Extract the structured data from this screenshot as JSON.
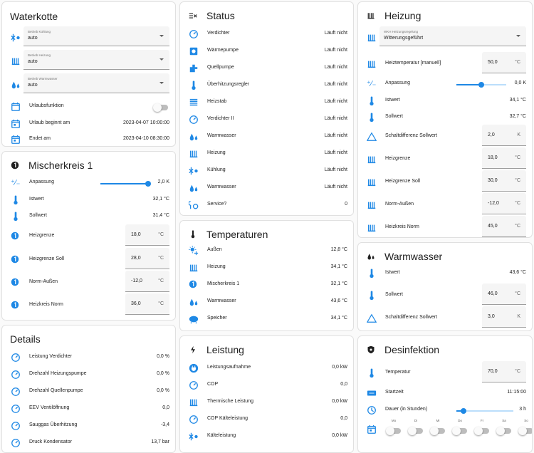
{
  "waterkotte": {
    "title": "Waterkotte",
    "selects": [
      {
        "label": "Betrieb Kühlung",
        "value": "auto"
      },
      {
        "label": "Betrieb Heizung",
        "value": "auto"
      },
      {
        "label": "Betrieb Warmwasser",
        "value": "auto"
      }
    ],
    "urlaub_label": "Urlaubsfunktion",
    "rows": [
      {
        "label": "Urlaub beginnt am",
        "value": "2023-04-07 10:00:00"
      },
      {
        "label": "Endet am",
        "value": "2023-04-10 08:30:00"
      }
    ]
  },
  "mischer": {
    "title": "Mischerkreis 1",
    "anpassung_label": "Anpassung",
    "anpassung_value": "2,0 K",
    "anpassung_fraction": 0.95,
    "rows": [
      {
        "label": "Istwert",
        "value": "32,1 °C"
      },
      {
        "label": "Sollwert",
        "value": "31,4 °C"
      }
    ],
    "inputs": [
      {
        "label": "Heizgrenze",
        "value": "18,0",
        "unit": "°C"
      },
      {
        "label": "Heizgrenze Soll",
        "value": "28,0",
        "unit": "°C"
      },
      {
        "label": "Norm-Außen",
        "value": "-12,0",
        "unit": "°C"
      },
      {
        "label": "Heizkreis Norm",
        "value": "36,0",
        "unit": "°C"
      }
    ]
  },
  "details": {
    "title": "Details",
    "rows": [
      {
        "label": "Leistung Verdichter",
        "value": "0,0 %"
      },
      {
        "label": "Drehzahl Heizungspumpe",
        "value": "0,0 %"
      },
      {
        "label": "Drehzahl Quellenpumpe",
        "value": "0,0 %"
      },
      {
        "label": "EEV Ventilöffnung",
        "value": "0,0"
      },
      {
        "label": "Sauggas Überhitzung",
        "value": "-3,4"
      },
      {
        "label": "Druck Kondensator",
        "value": "13,7 bar"
      }
    ]
  },
  "status": {
    "title": "Status",
    "rows": [
      {
        "label": "Verdichter",
        "value": "Läuft nicht",
        "icon": "gauge-icon"
      },
      {
        "label": "Wärmepumpe",
        "value": "Läuft nicht",
        "icon": "heat-pump-icon"
      },
      {
        "label": "Quellpumpe",
        "value": "Läuft nicht",
        "icon": "pump-icon"
      },
      {
        "label": "Überhitzungsregler",
        "value": "Läuft nicht",
        "icon": "thermometer-icon"
      },
      {
        "label": "Heizstab",
        "value": "Läuft nicht",
        "icon": "heating-rod-icon"
      },
      {
        "label": "Verdichter II",
        "value": "Läuft nicht",
        "icon": "gauge-icon"
      },
      {
        "label": "Warmwasser",
        "value": "Läuft nicht",
        "icon": "water-drops-icon"
      },
      {
        "label": "Heizung",
        "value": "Läuft nicht",
        "icon": "radiator-icon"
      },
      {
        "label": "Kühlung",
        "value": "Läuft nicht",
        "icon": "snow-sun-icon"
      },
      {
        "label": "Warmwasser",
        "value": "Läuft nicht",
        "icon": "water-drops-icon"
      },
      {
        "label": "Service?",
        "value": "0",
        "icon": "service-icon"
      }
    ]
  },
  "temperaturen": {
    "title": "Temperaturen",
    "rows": [
      {
        "label": "Außen",
        "value": "12,8 °C",
        "icon": "sun-snow-icon"
      },
      {
        "label": "Heizung",
        "value": "34,1 °C",
        "icon": "radiator-icon"
      },
      {
        "label": "Mischerkreis 1",
        "value": "32,1 °C",
        "icon": "circle-one-icon"
      },
      {
        "label": "Warmwasser",
        "value": "43,6 °C",
        "icon": "water-drops-icon"
      },
      {
        "label": "Speicher",
        "value": "34,1 °C",
        "icon": "tank-icon"
      }
    ]
  },
  "leistung": {
    "title": "Leistung",
    "rows": [
      {
        "label": "Leistungsaufnahme",
        "value": "0,0 kW",
        "icon": "power-plug-icon"
      },
      {
        "label": "COP",
        "value": "0,0",
        "icon": "gauge-icon"
      },
      {
        "label": "Thermische Leistung",
        "value": "0,0 kW",
        "icon": "radiator-icon"
      },
      {
        "label": "COP Kälteleistung",
        "value": "0,0",
        "icon": "gauge-icon"
      },
      {
        "label": "Kälteleistung",
        "value": "0,0 kW",
        "icon": "snow-sun-icon"
      }
    ]
  },
  "heizung": {
    "title": "Heizung",
    "select": {
      "label": "WKH Heizungsregelung",
      "value": "Witterungsgeführt"
    },
    "heiztemp": {
      "label": "Heiztemperatur [manuell]",
      "value": "50,0",
      "unit": "°C"
    },
    "anpassung_label": "Anpassung",
    "anpassung_value": "0,0 K",
    "anpassung_fraction": 0.5,
    "rows": [
      {
        "label": "Istwert",
        "value": "34,1 °C"
      },
      {
        "label": "Sollwert",
        "value": "32,7 °C"
      }
    ],
    "inputs": [
      {
        "label": "Schaltdifferenz Sollwert",
        "value": "2,0",
        "unit": "K",
        "icon": "triangle-icon"
      },
      {
        "label": "Heizgrenze",
        "value": "18,0",
        "unit": "°C",
        "icon": "radiator-icon"
      },
      {
        "label": "Heizgrenze Soll",
        "value": "30,0",
        "unit": "°C",
        "icon": "radiator-icon"
      },
      {
        "label": "Norm-Außen",
        "value": "-12,0",
        "unit": "°C",
        "icon": "radiator-icon"
      },
      {
        "label": "Heizkreis Norm",
        "value": "45,0",
        "unit": "°C",
        "icon": "radiator-icon"
      }
    ]
  },
  "warmwasser": {
    "title": "Warmwasser",
    "istwert": {
      "label": "Istwert",
      "value": "43,6 °C"
    },
    "inputs": [
      {
        "label": "Sollwert",
        "value": "46,0",
        "unit": "°C",
        "icon": "thermometer-icon"
      },
      {
        "label": "Schaltdifferenz Sollwert",
        "value": "3,0",
        "unit": "K",
        "icon": "triangle-icon"
      }
    ]
  },
  "desinfektion": {
    "title": "Desinfektion",
    "temperatur": {
      "label": "Temperatur",
      "value": "70,0",
      "unit": "°C"
    },
    "startzeit": {
      "label": "Startzeit",
      "value": "11:15:00"
    },
    "dauer": {
      "label": "Dauer (in Stunden)",
      "value": "3 h",
      "fraction": 0.12
    },
    "days": [
      "Mo",
      "Di",
      "Mi",
      "Do",
      "Fr",
      "Sa",
      "So"
    ]
  },
  "colors": {
    "accent": "#1e88e5",
    "card_bg": "#ffffff",
    "page_bg": "#fafafa"
  }
}
